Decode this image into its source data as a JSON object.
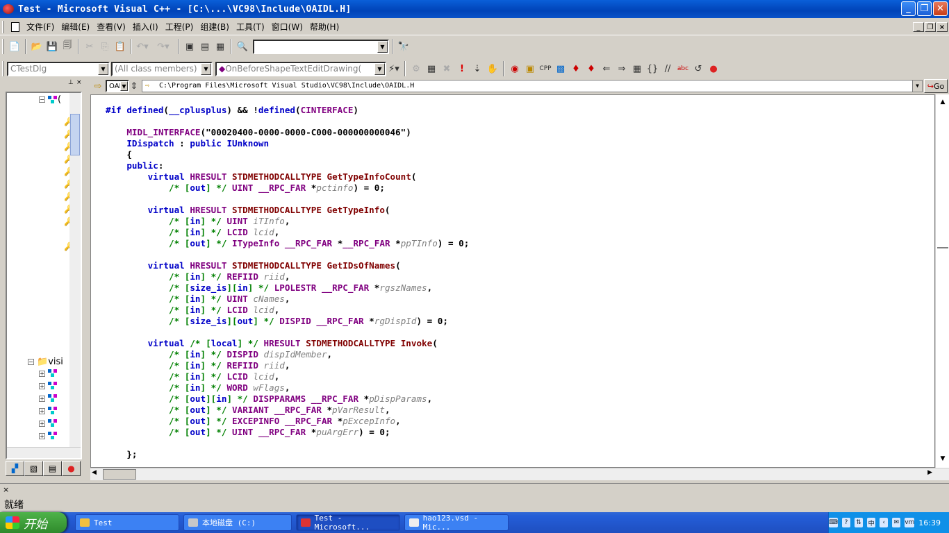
{
  "window": {
    "title": "Test - Microsoft Visual C++ - [C:\\...\\VC98\\Include\\OAIDL.H]"
  },
  "menu": [
    "文件(F)",
    "编辑(E)",
    "查看(V)",
    "插入(I)",
    "工程(P)",
    "组建(B)",
    "工具(T)",
    "窗口(W)",
    "帮助(H)"
  ],
  "wizardbar": {
    "class_combo": "CTestDlg",
    "filter_combo": "(All class members)",
    "member_combo": "OnBeforeShapeTextEditDrawing("
  },
  "navbar": {
    "file_combo": "OAI",
    "path": "C:\\Program Files\\Microsoft Visual Studio\\VC98\\Include\\OAIDL.H",
    "go_label": "Go"
  },
  "workspace": {
    "tree_folder_label": "visi",
    "node_stub": "("
  },
  "code": {
    "lines": [
      "#if defined(__cplusplus) && !defined(CINTERFACE)",
      "",
      "    MIDL_INTERFACE(\"00020400-0000-0000-C000-000000000046\")",
      "    IDispatch : public IUnknown",
      "    {",
      "    public:",
      "        virtual HRESULT STDMETHODCALLTYPE GetTypeInfoCount(",
      "            /* [out] */ UINT __RPC_FAR *pctinfo) = 0;",
      "",
      "        virtual HRESULT STDMETHODCALLTYPE GetTypeInfo(",
      "            /* [in] */ UINT iTInfo,",
      "            /* [in] */ LCID lcid,",
      "            /* [out] */ ITypeInfo __RPC_FAR *__RPC_FAR *ppTInfo) = 0;",
      "",
      "        virtual HRESULT STDMETHODCALLTYPE GetIDsOfNames(",
      "            /* [in] */ REFIID riid,",
      "            /* [size_is][in] */ LPOLESTR __RPC_FAR *rgszNames,",
      "            /* [in] */ UINT cNames,",
      "            /* [in] */ LCID lcid,",
      "            /* [size_is][out] */ DISPID __RPC_FAR *rgDispId) = 0;",
      "",
      "        virtual /* [local] */ HRESULT STDMETHODCALLTYPE Invoke(",
      "            /* [in] */ DISPID dispIdMember,",
      "            /* [in] */ REFIID riid,",
      "            /* [in] */ LCID lcid,",
      "            /* [in] */ WORD wFlags,",
      "            /* [out][in] */ DISPPARAMS __RPC_FAR *pDispParams,",
      "            /* [out] */ VARIANT __RPC_FAR *pVarResult,",
      "            /* [out] */ EXCEPINFO __RPC_FAR *pExcepInfo,",
      "            /* [out] */ UINT __RPC_FAR *puArgErr) = 0;",
      "",
      "    };"
    ]
  },
  "status": {
    "text": "就绪"
  },
  "taskbar": {
    "start_label": "开始",
    "tasks": [
      "Test",
      "本地磁盘 (C:)",
      "Test - Microsoft...",
      "hao123.vsd - Mic..."
    ],
    "clock": "16:39"
  },
  "colors": {
    "keyword": "#0000c8",
    "macro": "#800080",
    "function": "#800000",
    "comment": "#008000",
    "param": "#808080",
    "title_bar": "#0043b8"
  }
}
